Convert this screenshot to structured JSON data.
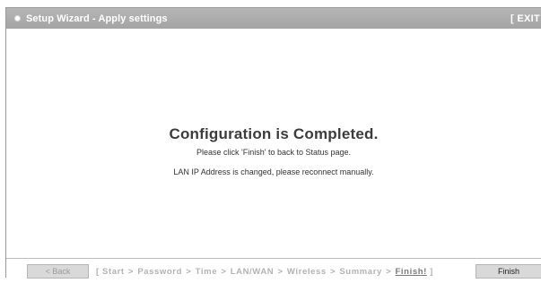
{
  "window": {
    "title": "Setup Wizard - Apply settings",
    "exit_label": "[ EXIT"
  },
  "content": {
    "headline": "Configuration is Completed.",
    "message1": "Please click 'Finish' to back to Status page.",
    "message2": "LAN IP Address is changed, please reconnect manually."
  },
  "footer": {
    "back_label": "< Back",
    "finish_label": "Finish",
    "steps_open": "[",
    "steps": [
      "Start",
      "Password",
      "Time",
      "LAN/WAN",
      "Wireless",
      "Summary"
    ],
    "current_step": "Finish!",
    "steps_close": "]",
    "separator": ">"
  },
  "colors": {
    "titlebar": "#a9a9a9",
    "button_bg": "#d9d9d9",
    "step_inactive": "#b3b3b3",
    "step_active": "#7a7a7a"
  }
}
